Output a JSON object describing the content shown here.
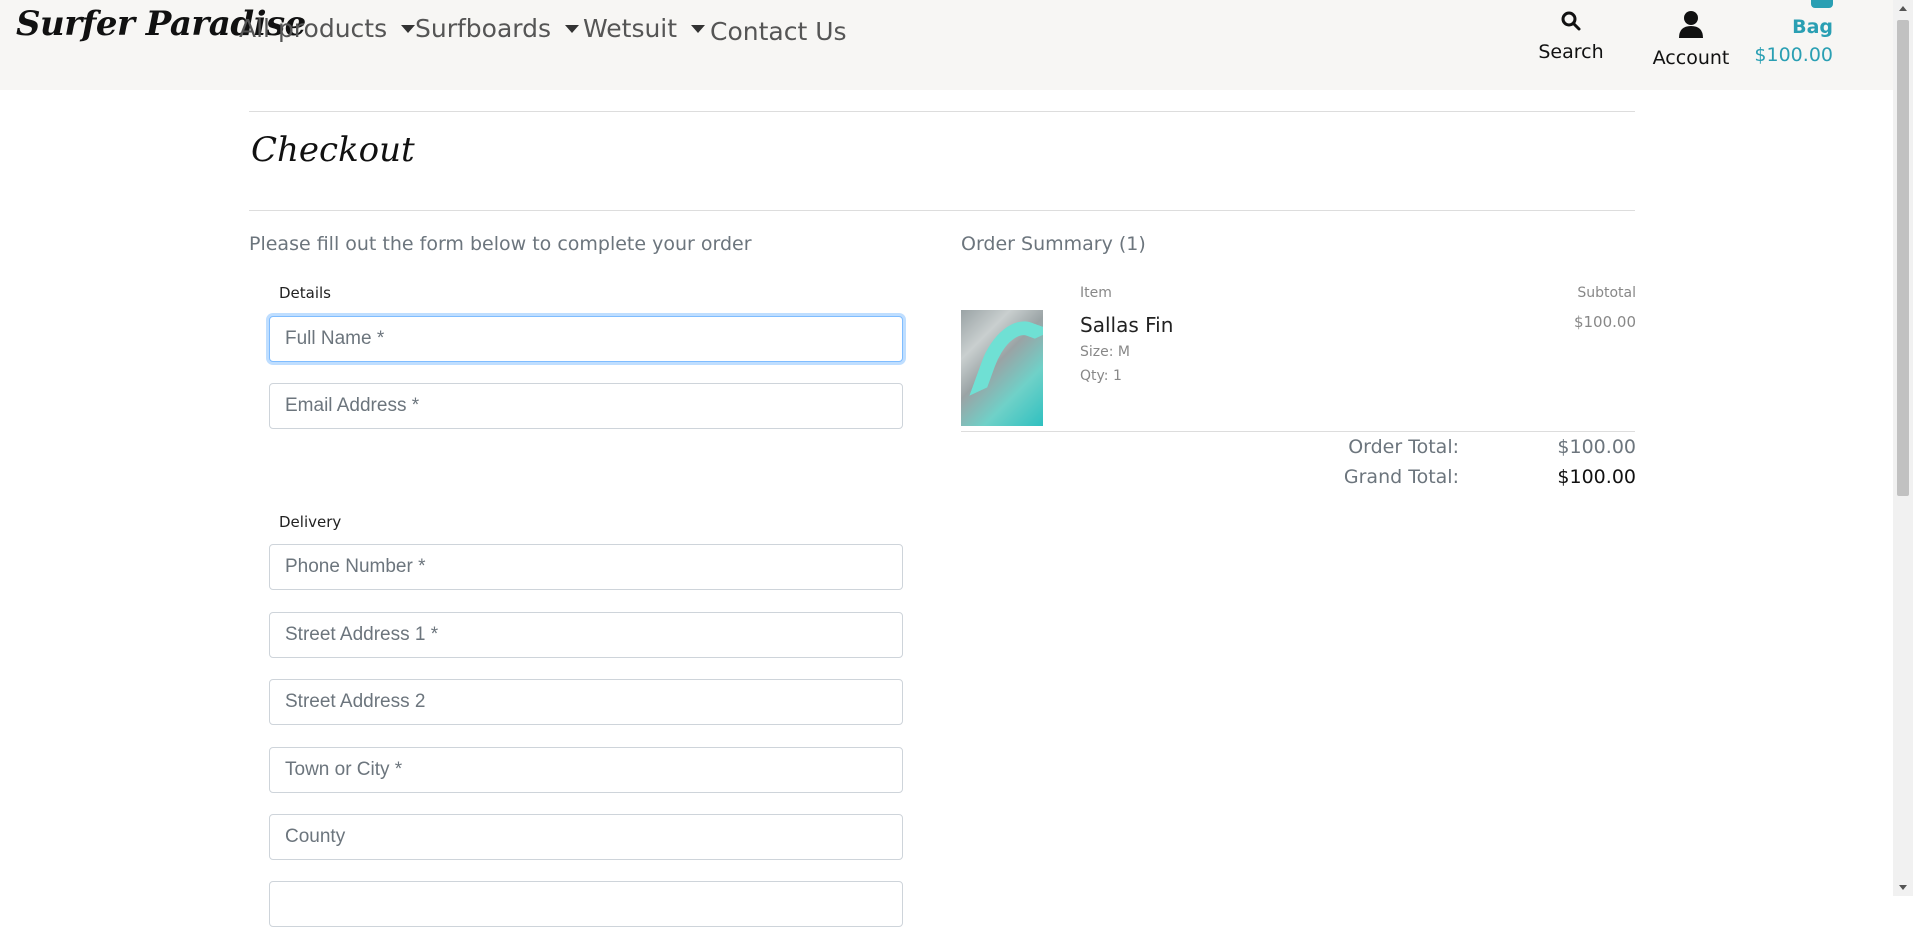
{
  "header": {
    "brand": "Surfer Paradise",
    "nav": [
      {
        "label": "All products"
      },
      {
        "label": "Surfboards"
      },
      {
        "label": "Wetsuit"
      },
      {
        "label": "Contact Us"
      }
    ],
    "search_label": "Search",
    "account_label": "Account",
    "bag_label": "Bag",
    "bag_amount": "$100.00"
  },
  "page": {
    "title": "Checkout",
    "lead": "Please fill out the form below to complete your order"
  },
  "form": {
    "details_legend": "Details",
    "delivery_legend": "Delivery",
    "fields": [
      {
        "placeholder": "Full Name *",
        "value": ""
      },
      {
        "placeholder": "Email Address *",
        "value": ""
      },
      {
        "placeholder": "Phone Number *",
        "value": ""
      },
      {
        "placeholder": "Street Address 1 *",
        "value": ""
      },
      {
        "placeholder": "Street Address 2",
        "value": ""
      },
      {
        "placeholder": "Town or City *",
        "value": ""
      },
      {
        "placeholder": "County",
        "value": ""
      }
    ]
  },
  "summary": {
    "title": "Order Summary (1)",
    "col_item": "Item",
    "col_subtotal": "Subtotal",
    "item": {
      "name": "Sallas Fin",
      "size": "Size: M",
      "qty": "Qty: 1",
      "subtotal": "$100.00"
    },
    "order_total_label": "Order Total:",
    "order_total_value": "$100.00",
    "grand_total_label": "Grand Total:",
    "grand_total_value": "$100.00"
  },
  "colors": {
    "accent": "#2a9fb3",
    "header_bg": "#f7f6f4"
  },
  "icons": [
    "search-icon",
    "user-icon",
    "caret-down-icon",
    "shopping-bag-icon"
  ]
}
